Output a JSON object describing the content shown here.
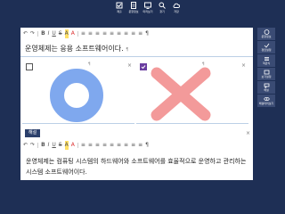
{
  "topbar": {
    "items": [
      {
        "label": "제출"
      },
      {
        "label": "문항정보"
      },
      {
        "label": "미리보기"
      },
      {
        "label": "찾기"
      },
      {
        "label": "저장"
      }
    ]
  },
  "sidebar": {
    "items": [
      {
        "label": "문항정보"
      },
      {
        "label": "정답설정"
      },
      {
        "label": "객관식"
      },
      {
        "label": "보기설정"
      },
      {
        "label": "해설"
      },
      {
        "label": "해설미리보기"
      }
    ]
  },
  "toolbar": {
    "undo": "↶",
    "redo": "↷",
    "bold": "B",
    "italic": "I",
    "underline": "U",
    "strike": "S",
    "highlight": "A",
    "color": "A",
    "list": "≡",
    "pilcrow": "¶"
  },
  "question": {
    "text": "운영체제는 응용 소프트웨어이다.",
    "mark": "¶"
  },
  "options": [
    {
      "checked": false,
      "mark": "¶",
      "close": "×",
      "shape": "circle",
      "color": "#7fa8ee"
    },
    {
      "checked": true,
      "mark": "¶",
      "close": "×",
      "shape": "cross",
      "color": "#f39a9a"
    }
  ],
  "explanation": {
    "tag": "해설",
    "close": "×",
    "text": "운영체제는 컴퓨팅 시스템의 하드웨어와 소프트웨어를 효율적으로 운영하고 관리하는 시스템 소프트웨어이다."
  },
  "colors": {
    "background": "#1e2f55",
    "accent": "#6a3ea0",
    "circle": "#7fa8ee",
    "cross": "#f39a9a"
  }
}
